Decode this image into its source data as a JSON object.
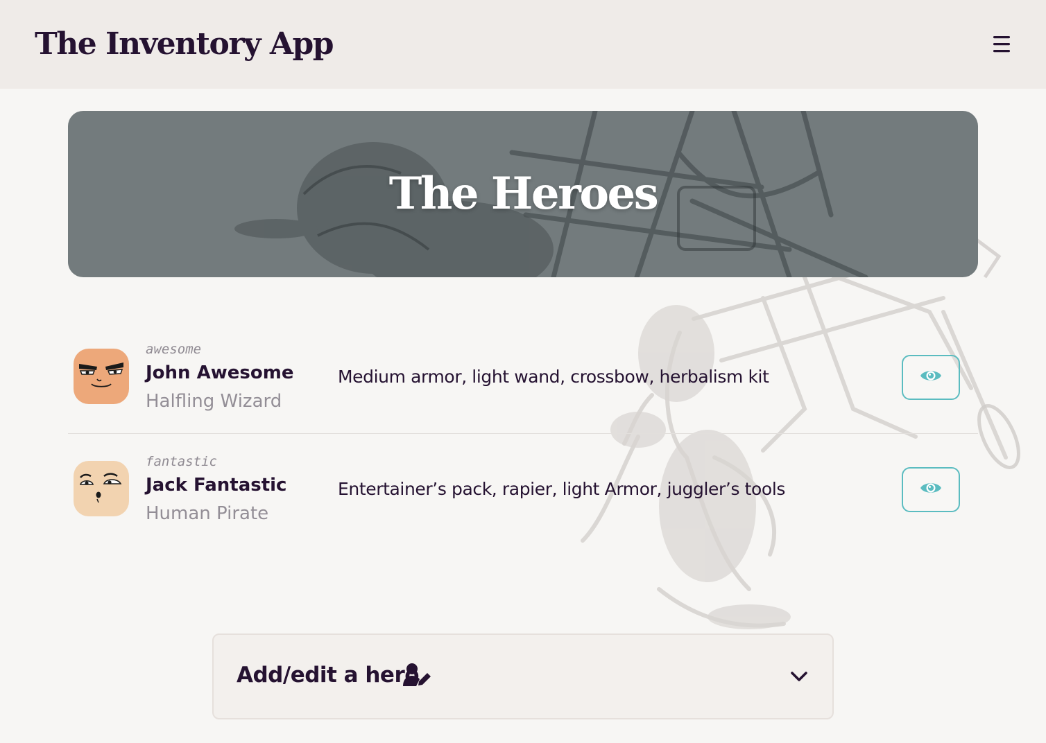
{
  "header": {
    "app_title": "The Inventory App",
    "menu_icon": "hamburger-menu-icon"
  },
  "banner": {
    "title": "The Heroes"
  },
  "heroes": [
    {
      "tag": "awesome",
      "name": "John Awesome",
      "class": "Halfling Wizard",
      "items": "Medium armor, light wand, crossbow, herbalism kit",
      "avatar_color": "#eda87a",
      "view_icon": "eye-icon"
    },
    {
      "tag": "fantastic",
      "name": "Jack Fantastic",
      "class": "Human Pirate",
      "items": "Entertainer’s pack, rapier, light Armor, juggler’s tools",
      "avatar_color": "#f2d3b0",
      "view_icon": "eye-icon"
    }
  ],
  "add_edit": {
    "label": "Add/edit a hero",
    "icon": "user-edit-icon",
    "toggle_icon": "chevron-down-icon"
  },
  "colors": {
    "text_dark": "#251231",
    "accent_teal": "#5bbcc0",
    "header_bg": "#efebe8",
    "banner_bg": "#737b7d",
    "page_bg": "#f7f6f4"
  }
}
